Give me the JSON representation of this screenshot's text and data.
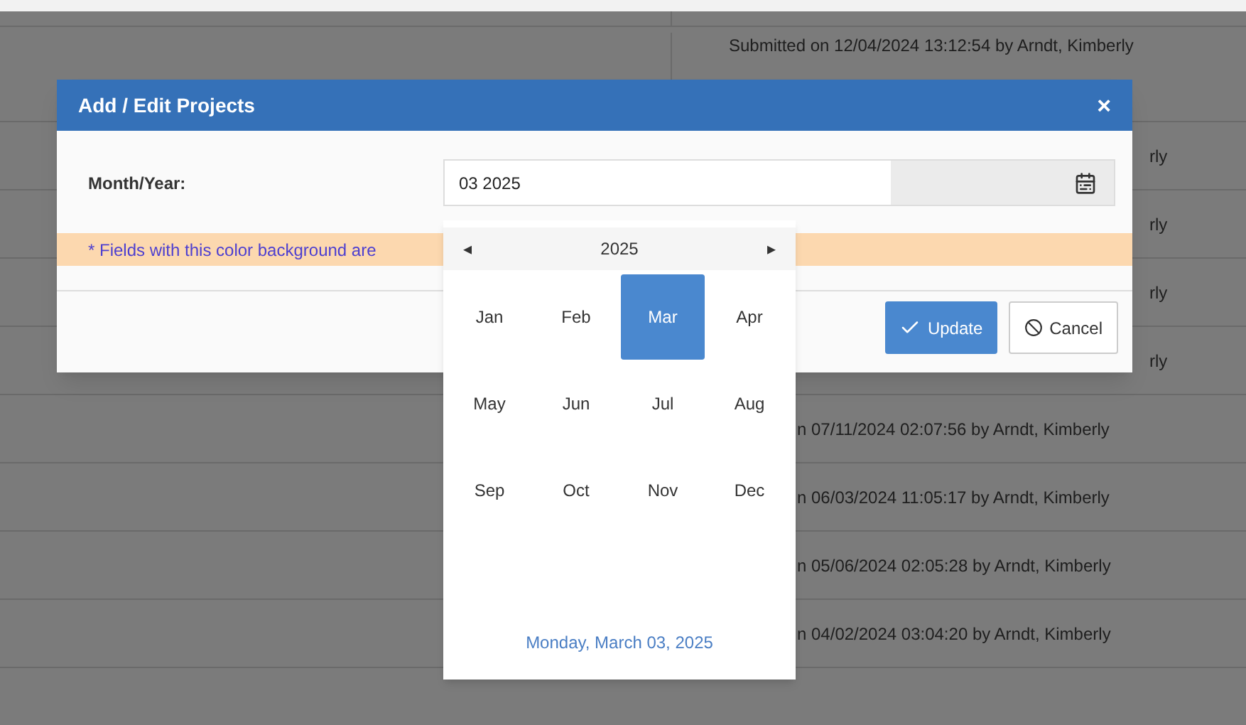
{
  "background_table": {
    "rows": [
      {
        "column_2": "Submitted on 12/04/2024 13:12:54 by Arndt, Kimberly",
        "kind": "full"
      },
      {
        "column_2": "rly",
        "kind": "tail"
      },
      {
        "column_2": "rly",
        "kind": "tail"
      },
      {
        "column_2": "rly",
        "kind": "tail"
      },
      {
        "column_2": "rly",
        "kind": "tail"
      },
      {
        "column_2": "n 07/11/2024 02:07:56 by Arndt, Kimberly",
        "kind": "mid"
      },
      {
        "column_2": "n 06/03/2024 11:05:17 by Arndt, Kimberly",
        "kind": "mid"
      },
      {
        "column_2": "n 05/06/2024 02:05:28 by Arndt, Kimberly",
        "kind": "mid"
      },
      {
        "column_2": "n 04/02/2024 03:04:20 by Arndt, Kimberly",
        "kind": "mid"
      }
    ]
  },
  "dialog": {
    "title": "Add / Edit Projects",
    "close": "×",
    "field_label": "Month/Year:",
    "field_value": "03 2025",
    "note": "* Fields with this color background are",
    "buttons": [
      {
        "label": "Update",
        "kind": "primary"
      },
      {
        "label": "Cancel",
        "kind": "default"
      }
    ]
  },
  "datepicker": {
    "prev": "◂",
    "year": "2025",
    "next": "▸",
    "months": [
      {
        "label": "Jan",
        "selected": false
      },
      {
        "label": "Feb",
        "selected": false
      },
      {
        "label": "Mar",
        "selected": true
      },
      {
        "label": "Apr",
        "selected": false
      },
      {
        "label": "May",
        "selected": false
      },
      {
        "label": "Jun",
        "selected": false
      },
      {
        "label": "Jul",
        "selected": false
      },
      {
        "label": "Aug",
        "selected": false
      },
      {
        "label": "Sep",
        "selected": false
      },
      {
        "label": "Oct",
        "selected": false
      },
      {
        "label": "Nov",
        "selected": false
      },
      {
        "label": "Dec",
        "selected": false
      }
    ],
    "footer": "Monday, March 03, 2025"
  }
}
